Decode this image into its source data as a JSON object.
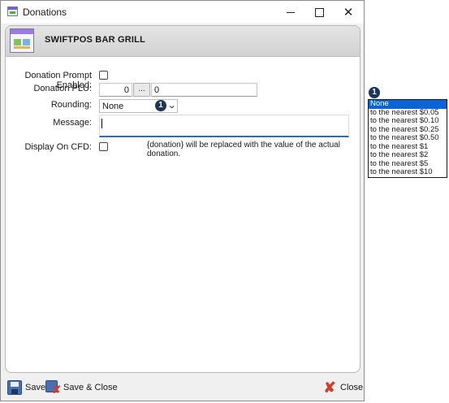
{
  "window": {
    "title": "Donations"
  },
  "header": {
    "title": "SWIFTPOS BAR  GRILL"
  },
  "form": {
    "prompt_label": "Donation Prompt Enabled:",
    "prompt_checked": false,
    "plu_label": "Donation PLU:",
    "plu_code": "0",
    "plu_button": "...",
    "plu_value": "0",
    "rounding_label": "Rounding:",
    "rounding_value": "None",
    "message_label": "Message:",
    "message_value": "",
    "cfd_label": "Display On CFD:",
    "cfd_checked": false,
    "hint": "{donation} will be replaced with the value of the actual donation."
  },
  "annotations": {
    "badge_combo": "1",
    "badge_list": "1"
  },
  "rounding_options": [
    "None",
    "to the nearest $0.05",
    "to the nearest $0.10",
    "to the nearest $0.25",
    "to the nearest $0.50",
    "to the nearest $1",
    "to the nearest $2",
    "to the nearest $5",
    "to the nearest $10"
  ],
  "toolbar": {
    "save": "Save",
    "save_close": "Save & Close",
    "close": "Close"
  },
  "colors": {
    "selection": "#0a64d8",
    "badge": "#1c3557",
    "focus_underline": "#2f6bb3"
  }
}
